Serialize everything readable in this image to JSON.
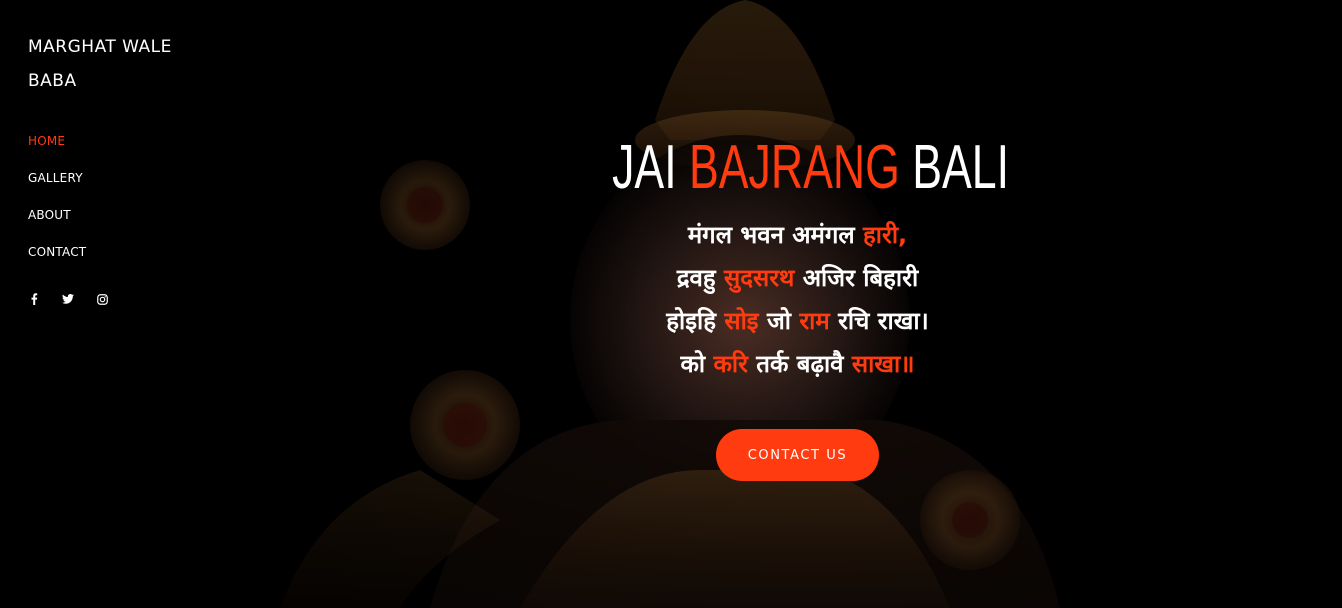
{
  "sidebar": {
    "brand_line1": "MARGHAT WALE",
    "brand_line2": "BABA",
    "nav": [
      {
        "label": "HOME",
        "active": true
      },
      {
        "label": "GALLERY",
        "active": false
      },
      {
        "label": "ABOUT",
        "active": false
      },
      {
        "label": "CONTACT",
        "active": false
      }
    ],
    "social": [
      {
        "icon": "facebook-icon",
        "glyph": "f"
      },
      {
        "icon": "twitter-icon",
        "glyph": "🐦"
      },
      {
        "icon": "instagram-icon",
        "glyph": "◎"
      }
    ]
  },
  "hero": {
    "title_part1": "JAI ",
    "title_accent": "BAJRANG",
    "title_part2": " BALI",
    "verse": {
      "line1_a": "मंगल भवन अमंगल ",
      "line1_b": "हारी,",
      "line2_a": "द्रवहु ",
      "line2_b": "सुदसरथ",
      "line2_c": " अजिर बिहारी",
      "line3_a": "होइहि ",
      "line3_b": "सोइ",
      "line3_c": " जो ",
      "line3_d": "राम",
      "line3_e": " रचि राखा।",
      "line4_a": "को ",
      "line4_b": "करि",
      "line4_c": " तर्क बढ़ावै ",
      "line4_d": "साखा॥"
    },
    "cta_label": "CONTACT US"
  },
  "colors": {
    "accent": "#ff3b0f",
    "background": "#000000",
    "text": "#ffffff"
  }
}
